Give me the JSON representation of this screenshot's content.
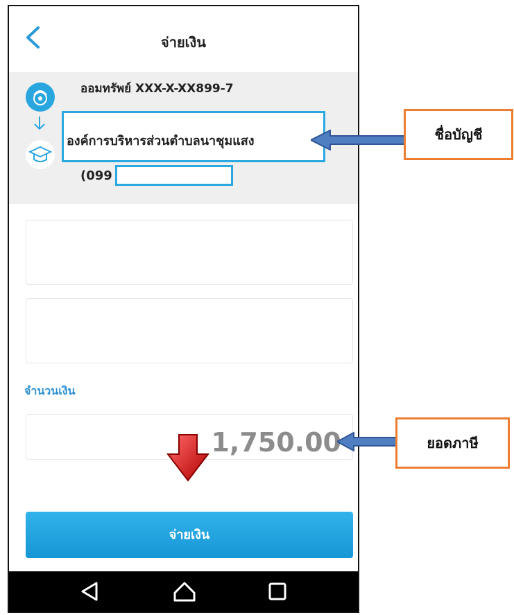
{
  "header": {
    "title": "จ่ายเงิน"
  },
  "from_account": {
    "name": "ออมทรัพย์ XXX-X-XX899-7"
  },
  "payee": {
    "name": "องค์การบริหารส่วนตำบลนาชุมแสง",
    "ref_prefix": "(099"
  },
  "amount": {
    "label": "จำนวนเงิน",
    "value": "1,750.00"
  },
  "actions": {
    "pay_label": "จ่ายเงิน"
  },
  "annotations": {
    "account_name_callout": "ชื่อบัญชี",
    "tax_amount_callout": "ยอดภาษี"
  },
  "colors": {
    "accent": "#29a9e0",
    "callout_border": "#ed7d31",
    "amount_label": "#2b8fd6"
  },
  "icons": [
    "back-icon",
    "bank-logo-icon",
    "arrow-down-icon",
    "graduation-cap-icon",
    "red-down-arrow-icon",
    "nav-back-icon",
    "nav-home-icon",
    "nav-recents-icon"
  ]
}
